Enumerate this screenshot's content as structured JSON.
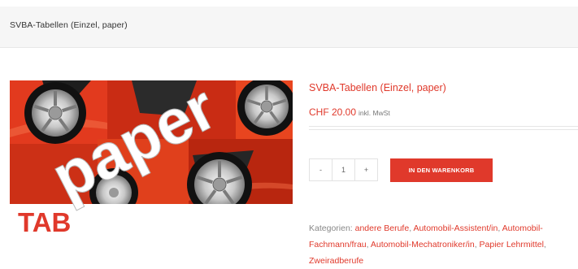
{
  "breadcrumb": {
    "title": "SVBA-Tabellen (Einzel, paper)"
  },
  "product": {
    "image": {
      "word": "paper",
      "badge": "TAB"
    },
    "title": "SVBA-Tabellen (Einzel, paper)",
    "price": {
      "amount": "CHF 20.00",
      "suffix": "inkl. MwSt"
    },
    "quantity": {
      "minus": "-",
      "value": "1",
      "plus": "+"
    },
    "add_to_cart_label": "IN DEN WARENKORB",
    "categories": {
      "label": "Kategorien:",
      "items": [
        {
          "text": "andere Berufe",
          "sep": ", "
        },
        {
          "text": "Automobil-Assistent/in",
          "sep": ", "
        },
        {
          "text": "Automobil-Fachmann/frau",
          "sep": ", "
        },
        {
          "text": "Automobil-Mechatroniker/in",
          "sep": ", "
        },
        {
          "text": "Papier Lehrmittel",
          "sep": ", "
        },
        {
          "text": "Zweiradberufe",
          "sep": ""
        }
      ]
    }
  },
  "colors": {
    "accent": "#e0392b",
    "breadcrumb_bg": "#f6f6f6",
    "car_red": "#e23a1e"
  }
}
